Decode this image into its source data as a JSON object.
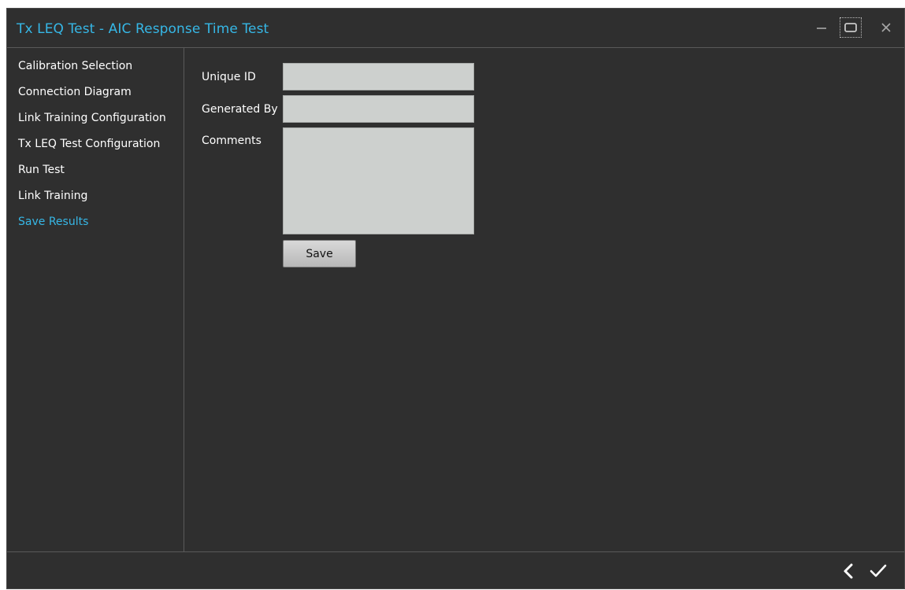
{
  "window": {
    "title": "Tx LEQ Test - AIC Response Time Test",
    "accent_color": "#36b7e6",
    "controls": [
      "minimize-icon",
      "maximize-icon",
      "close-icon"
    ]
  },
  "sidebar": {
    "items": [
      {
        "label": "Calibration Selection",
        "active": false
      },
      {
        "label": "Connection Diagram",
        "active": false
      },
      {
        "label": "Link Training Configuration",
        "active": false
      },
      {
        "label": "Tx LEQ Test Configuration",
        "active": false
      },
      {
        "label": "Run Test",
        "active": false
      },
      {
        "label": "Link Training",
        "active": false
      },
      {
        "label": "Save Results",
        "active": true
      }
    ]
  },
  "form": {
    "unique_id_label": "Unique ID",
    "unique_id_value": "",
    "generated_by_label": "Generated By",
    "generated_by_value": "",
    "comments_label": "Comments",
    "comments_value": "",
    "save_label": "Save"
  },
  "footer": {
    "icons": [
      "chevron-left-icon",
      "checkmark-icon"
    ]
  }
}
